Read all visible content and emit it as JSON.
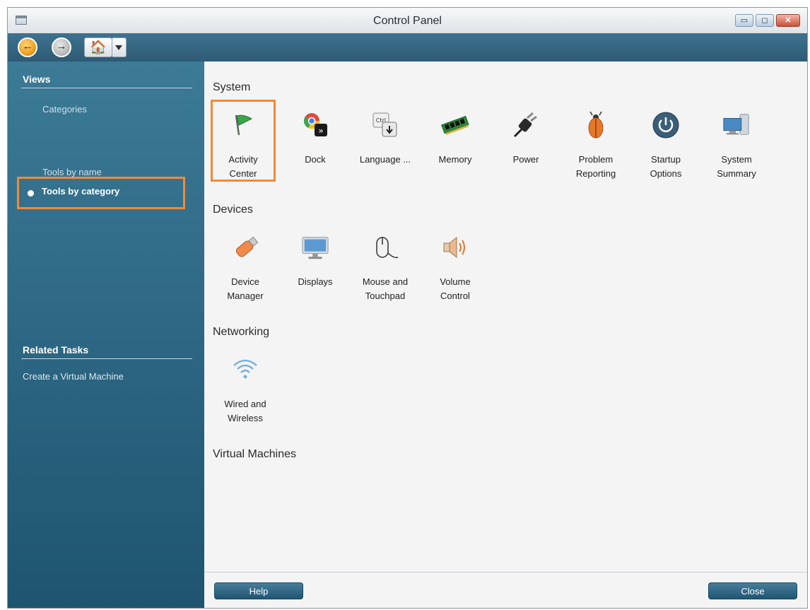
{
  "window": {
    "title": "Control Panel",
    "min_glyph": "▭",
    "max_glyph": "◻",
    "close_glyph": "✕"
  },
  "toolbar": {
    "back_glyph": "←",
    "forward_glyph": "→",
    "home_glyph": "🏠"
  },
  "sidebar": {
    "views_heading": "Views",
    "views": [
      {
        "label": "Categories",
        "selected": false
      },
      {
        "label": "Tools by category",
        "selected": true
      },
      {
        "label": "Tools by name",
        "selected": false
      }
    ],
    "related_heading": "Related Tasks",
    "tasks": [
      {
        "label": "Create a Virtual Machine"
      }
    ]
  },
  "categories": [
    {
      "name": "System",
      "tools": [
        {
          "label": "Activity\nCenter",
          "icon": "flag-icon",
          "highlighted": true
        },
        {
          "label": "Dock",
          "icon": "dock-icon"
        },
        {
          "label": "Language ...",
          "icon": "keyboard-keys-icon"
        },
        {
          "label": "Memory",
          "icon": "memory-chip-icon"
        },
        {
          "label": "Power",
          "icon": "power-plug-icon"
        },
        {
          "label": "Problem\nReporting",
          "icon": "ladybug-icon"
        },
        {
          "label": "Startup\nOptions",
          "icon": "power-button-icon"
        },
        {
          "label": "System\nSummary",
          "icon": "computer-icon"
        }
      ]
    },
    {
      "name": "Devices",
      "tools": [
        {
          "label": "Device\nManager",
          "icon": "usb-drive-icon"
        },
        {
          "label": "Displays",
          "icon": "monitor-icon"
        },
        {
          "label": "Mouse and\nTouchpad",
          "icon": "mouse-icon"
        },
        {
          "label": "Volume\nControl",
          "icon": "speaker-icon"
        }
      ]
    },
    {
      "name": "Networking",
      "tools": [
        {
          "label": "Wired and\nWireless",
          "icon": "wifi-icon"
        }
      ]
    },
    {
      "name": "Virtual Machines",
      "tools": []
    }
  ],
  "footer": {
    "help_label": "Help",
    "close_label": "Close"
  },
  "colors": {
    "sidebar_top": "#3c7a96",
    "sidebar_bottom": "#1e5470",
    "highlight": "#f08a3a",
    "button": "#2a6482"
  }
}
